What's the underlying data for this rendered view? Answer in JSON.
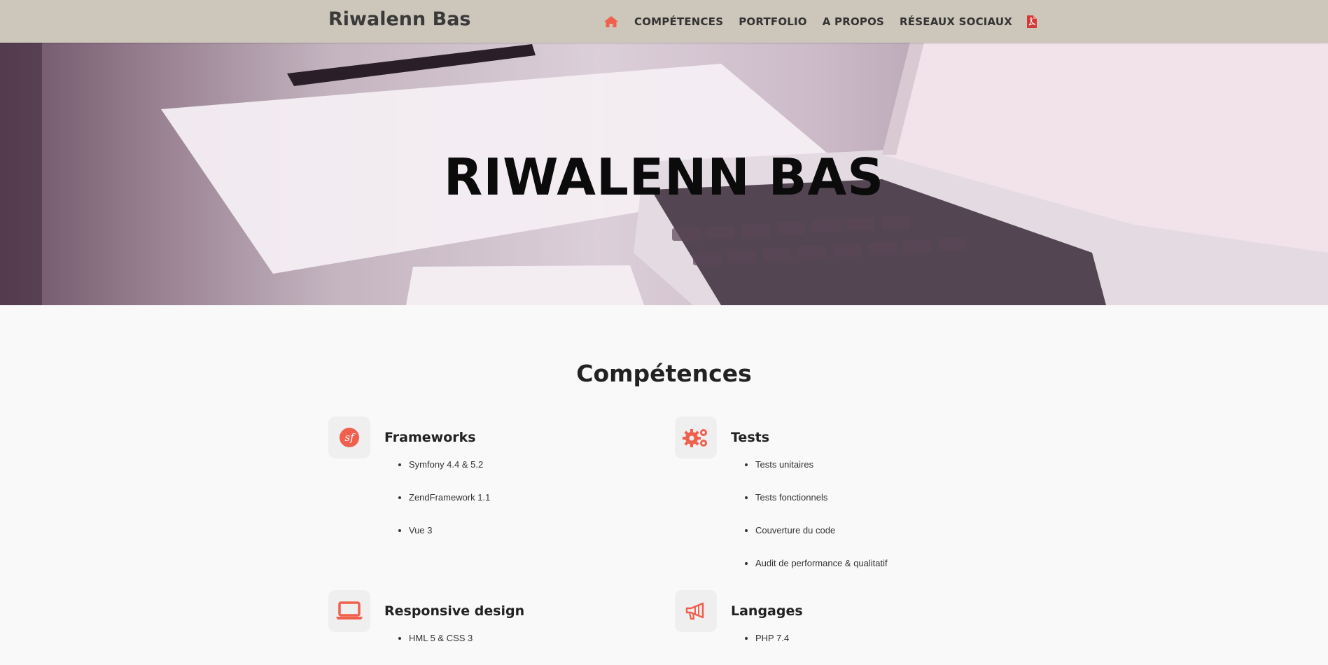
{
  "header": {
    "brand": "Riwalenn Bas",
    "nav": [
      {
        "label": "COMPÉTENCES"
      },
      {
        "label": "PORTFOLIO"
      },
      {
        "label": "A PROPOS"
      },
      {
        "label": "RÉSEAUX SOCIAUX"
      }
    ],
    "icons": {
      "home": "home-icon",
      "pdf": "pdf-file-icon"
    }
  },
  "hero": {
    "title": "RIWALENN BAS"
  },
  "competences": {
    "title": "Compétences",
    "skills": [
      {
        "title": "Frameworks",
        "icon": "symfony-icon",
        "items": [
          "Symfony 4.4 & 5.2",
          "ZendFramework 1.1",
          "Vue 3"
        ]
      },
      {
        "title": "Tests",
        "icon": "gears-icon",
        "items": [
          "Tests unitaires",
          "Tests fonctionnels",
          "Couverture du code",
          "Audit de performance & qualitatif"
        ]
      },
      {
        "title": "Responsive design",
        "icon": "laptop-icon",
        "items": [
          "HML 5 & CSS 3"
        ]
      },
      {
        "title": "Langages",
        "icon": "megaphone-icon",
        "items": [
          "PHP 7.4"
        ]
      }
    ]
  },
  "colors": {
    "accent": "#f0604d",
    "pdf": "#d23a3a",
    "header_bg": "#cdc6ba",
    "page_bg": "#f9f9f9"
  }
}
